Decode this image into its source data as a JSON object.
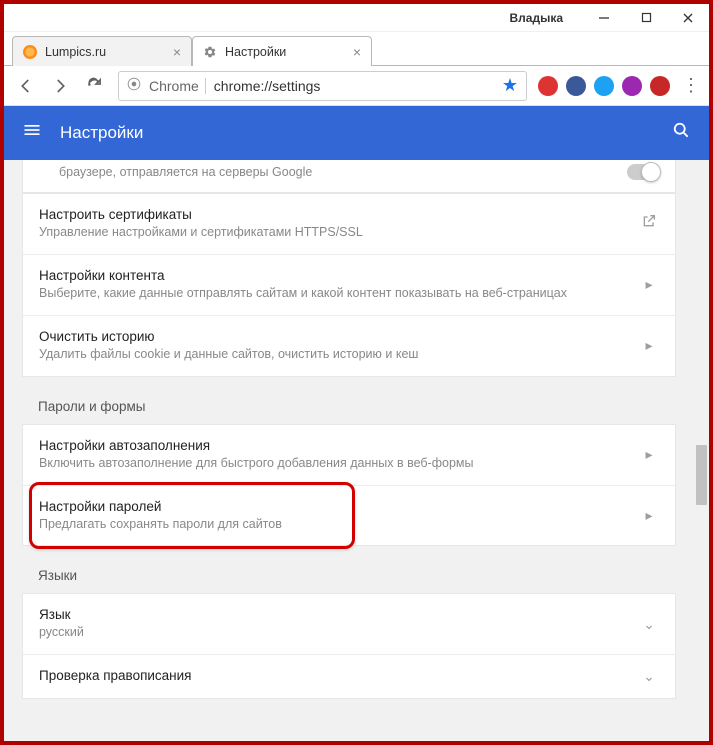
{
  "window": {
    "user_label": "Владыка"
  },
  "tabs": [
    {
      "label": "Lumpics.ru"
    },
    {
      "label": "Настройки"
    }
  ],
  "omnibox": {
    "scheme_label": "Chrome",
    "url": "chrome://settings"
  },
  "header": {
    "title": "Настройки"
  },
  "privacy_section": {
    "partial_row_sub": "браузере, отправляется на серверы Google",
    "rows": [
      {
        "title": "Настроить сертификаты",
        "sub": "Управление настройками и сертификатами HTTPS/SSL",
        "icon": "external"
      },
      {
        "title": "Настройки контента",
        "sub": "Выберите, какие данные отправлять сайтам и какой контент показывать на веб-страницах",
        "icon": "chevron"
      },
      {
        "title": "Очистить историю",
        "sub": "Удалить файлы cookie и данные сайтов, очистить историю и кеш",
        "icon": "chevron"
      }
    ]
  },
  "passwords_section": {
    "heading": "Пароли и формы",
    "rows": [
      {
        "title": "Настройки автозаполнения",
        "sub": "Включить автозаполнение для быстрого добавления данных в веб-формы",
        "icon": "chevron"
      },
      {
        "title": "Настройки паролей",
        "sub": "Предлагать сохранять пароли для сайтов",
        "icon": "chevron"
      }
    ]
  },
  "languages_section": {
    "heading": "Языки",
    "rows": [
      {
        "title": "Язык",
        "sub": "русский",
        "icon": "caret"
      },
      {
        "title": "Проверка правописания",
        "sub": "",
        "icon": "caret"
      }
    ]
  }
}
